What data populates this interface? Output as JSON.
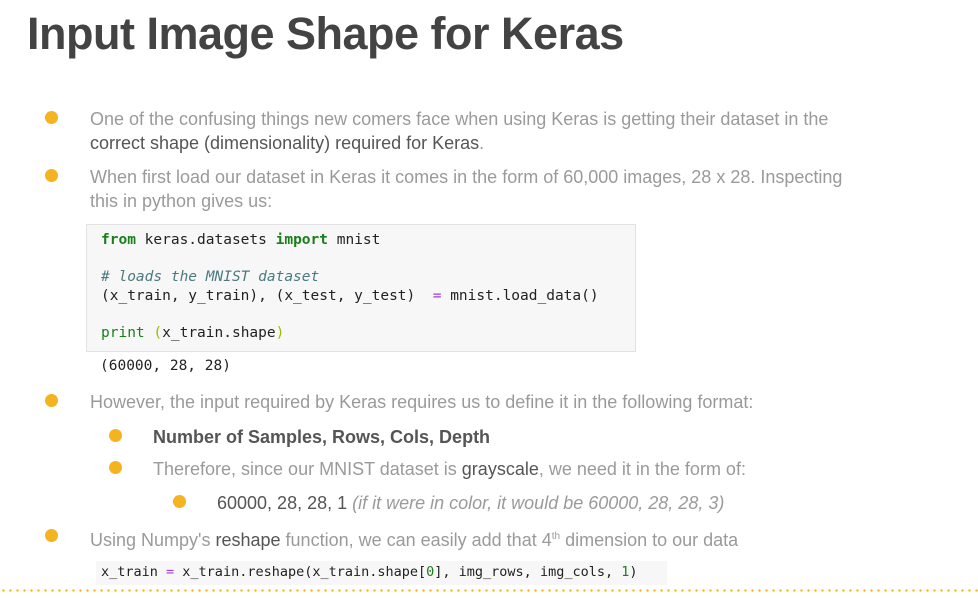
{
  "title": "Input Image Shape for Keras",
  "bullets": {
    "b1_pre": "One of the confusing things new comers face when using Keras is getting their dataset in the",
    "b1_bold": "correct shape (dimensionality) required for Keras",
    "b1_post": ".",
    "b2_line1": "When first load our dataset in Keras it comes in the form of 60,000 images, 28 x 28. Inspecting",
    "b2_line2": "this in python gives us:",
    "b3": "However, the input required by Keras requires us to define it in the following format:",
    "b3a": "Number of Samples, Rows, Cols, Depth",
    "b3b_pre": "Therefore, since our MNIST dataset is ",
    "b3b_bold": "grayscale",
    "b3b_post": ", we need it in the form of:",
    "b3b1_main": "60000, 28, 28, 1 ",
    "b3b1_italic": "(if it were in color, it would be 60000, 28, 28, 3)",
    "b4_pre": "Using Numpy's ",
    "b4_bold": "reshape",
    "b4_mid": " function, we can easily add that 4",
    "b4_sup": "th",
    "b4_post": " dimension to our data"
  },
  "code": {
    "l1_kw1": "from",
    "l1_mid": " keras.datasets ",
    "l1_kw2": "import",
    "l1_end": " mnist",
    "l2_comment": "# loads the MNIST dataset",
    "l3_lhs": "(x_train, y_train), (x_test, y_test)  ",
    "l3_op": "=",
    "l3_rhs": " mnist.load_data()",
    "l4_fn": "print",
    "l4_open": " (",
    "l4_arg": "x_train.shape",
    "l4_close": ")",
    "output": "(60000, 28, 28)"
  },
  "code2": {
    "lhs": "x_train ",
    "op": "=",
    "mid": " x_train.reshape(x_train.shape[",
    "zero": "0",
    "mid2": "], img_rows, img_cols, ",
    "one": "1",
    "end": ")"
  },
  "colors": {
    "accent": "#f4b321",
    "title": "#434343",
    "text": "#9a9a9a"
  }
}
